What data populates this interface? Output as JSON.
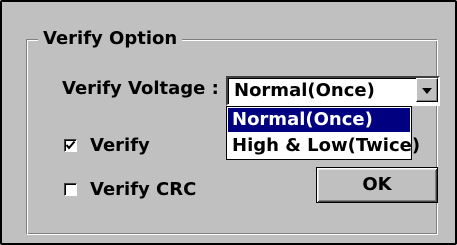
{
  "dialog": {
    "group_title": "Verify Option",
    "verify_voltage": {
      "label": "Verify Voltage :",
      "selected": "Normal(Once)",
      "options": [
        "Normal(Once)",
        "High & Low(Twice)"
      ]
    },
    "verify_checkbox": {
      "label": "Verify",
      "checked": true
    },
    "verify_crc_checkbox": {
      "label": "Verify CRC",
      "checked": false
    },
    "ok_button": {
      "label": "OK"
    }
  },
  "colors": {
    "face": "#c0c0c0",
    "highlight": "#000080",
    "window": "#ffffff"
  },
  "icons": {
    "dropdown_arrow": "chevron-down-icon",
    "check": "checkmark-icon"
  }
}
